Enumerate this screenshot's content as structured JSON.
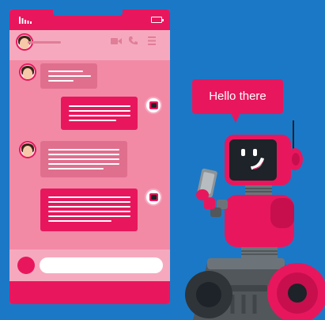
{
  "speech_bubble": {
    "text": "Hello there"
  },
  "composer": {
    "placeholder": ""
  },
  "colors": {
    "background": "#1b78c7",
    "brand_pink": "#e8175d",
    "phone_body": "#f28aa6",
    "header_light": "#f6a9be",
    "incoming_bubble": "#e06f8e",
    "robot_dark": "#3f4549"
  },
  "icons": [
    "signal-icon",
    "battery-icon",
    "video-icon",
    "call-icon",
    "menu-icon",
    "user-avatar",
    "robot-avatar",
    "smartphone-icon"
  ],
  "messages": [
    {
      "sender": "user",
      "lines": 3
    },
    {
      "sender": "robot",
      "lines": 4
    },
    {
      "sender": "user",
      "lines": 5
    },
    {
      "sender": "robot",
      "lines": 6
    }
  ]
}
